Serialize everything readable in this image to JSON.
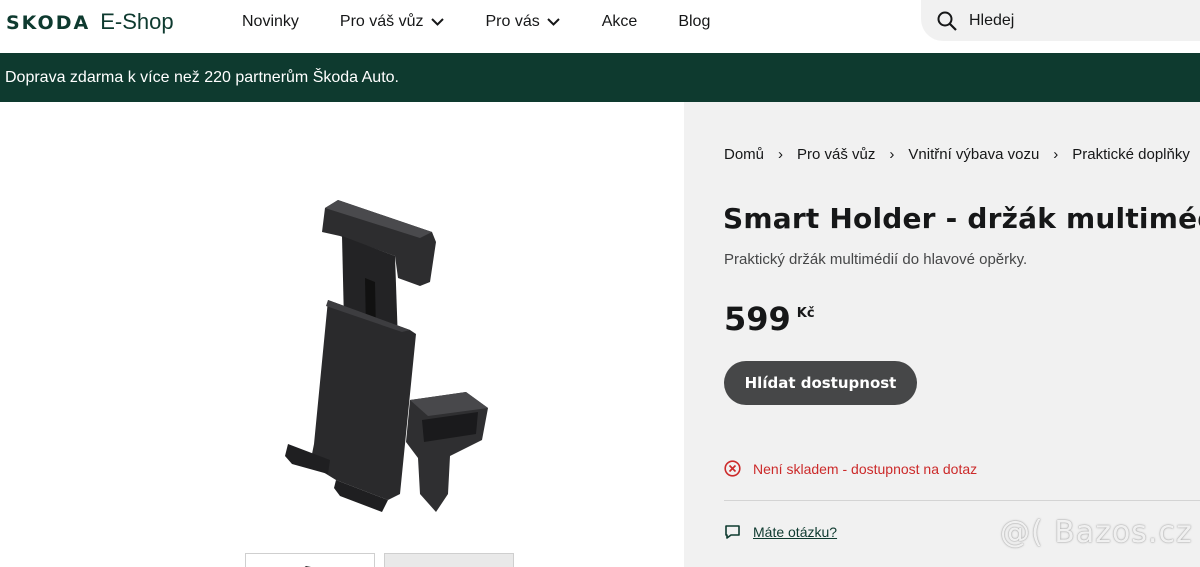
{
  "header": {
    "logo_brand": "SKODA",
    "logo_shop": "E-Shop",
    "nav": [
      {
        "label": "Novinky",
        "has_dropdown": false
      },
      {
        "label": "Pro váš vůz",
        "has_dropdown": true
      },
      {
        "label": "Pro vás",
        "has_dropdown": true
      },
      {
        "label": "Akce",
        "has_dropdown": false
      },
      {
        "label": "Blog",
        "has_dropdown": false
      }
    ],
    "search": {
      "placeholder": "Hledej",
      "icon": "search-icon"
    }
  },
  "banner": {
    "text": "Doprava zdarma k více než 220 partnerům Škoda Auto."
  },
  "breadcrumb": [
    "Domů",
    "Pro váš vůz",
    "Vnitřní výbava vozu",
    "Praktické doplňky"
  ],
  "product": {
    "title": "Smart Holder - držák multimédií",
    "subtitle": "Praktický držák multimédií do hlavové opěrky.",
    "price": "599",
    "currency": "Kč",
    "watch_button": "Hlídat dostupnost",
    "stock_status": "Není skladem - dostupnost na dotaz",
    "question_link": "Máte otázku?"
  },
  "watermark": "@( Bazos.cz",
  "colors": {
    "brand_green": "#0e3a2f",
    "panel_bg": "#f1f1f1",
    "button_bg": "#464748",
    "stock_red": "#cc2a2a"
  }
}
